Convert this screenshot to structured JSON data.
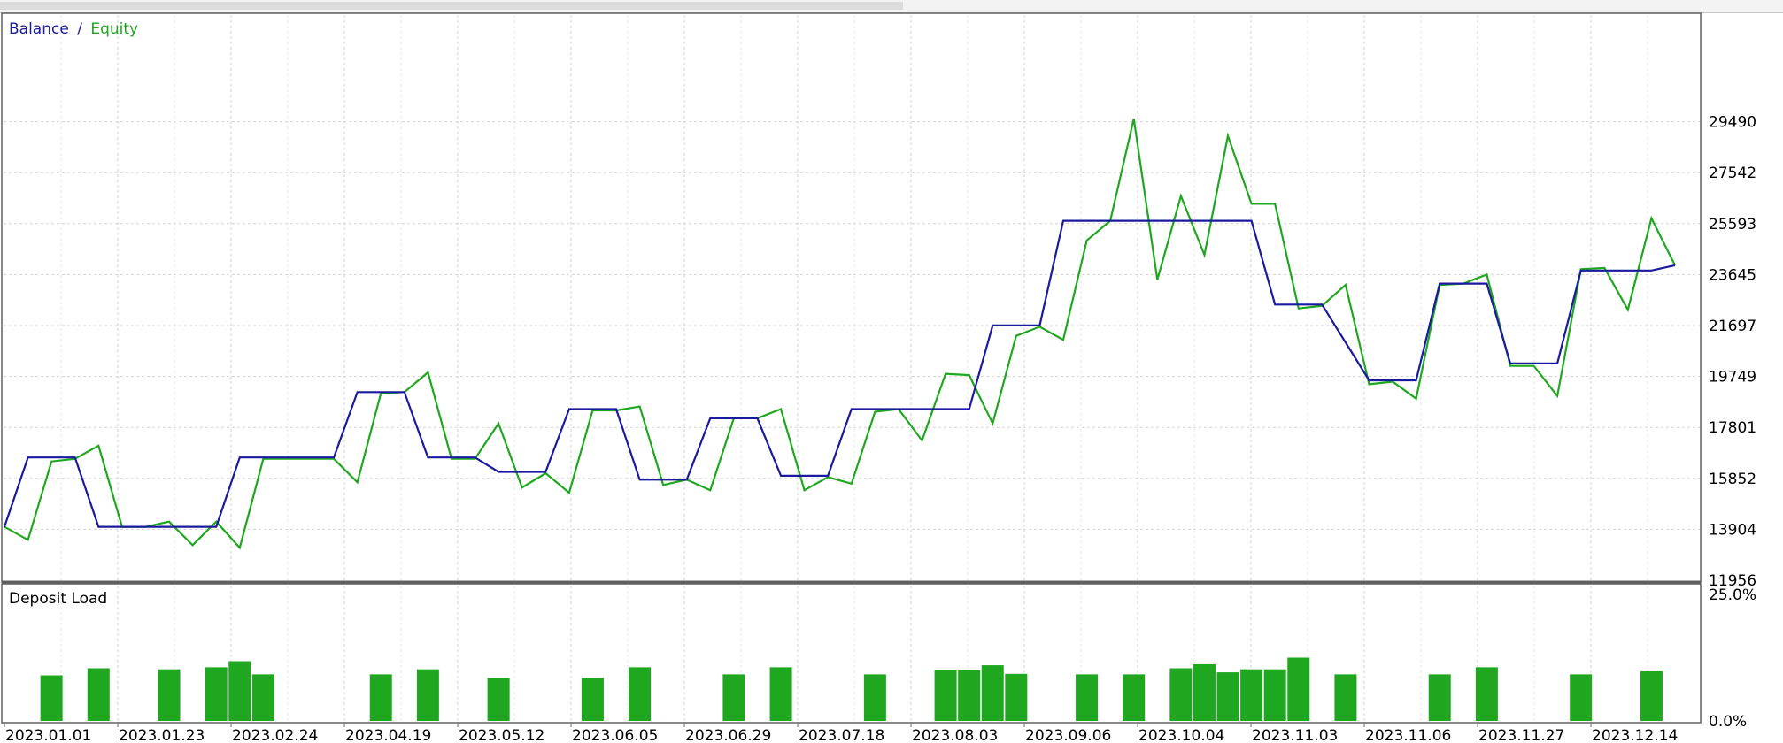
{
  "chart_data": [
    {
      "type": "line",
      "title": "",
      "legend": {
        "entries": [
          {
            "label": "Balance",
            "color": "#1a1a9e"
          },
          {
            "label": "Equity",
            "color": "#1fa71f"
          }
        ],
        "separator": "/",
        "placement": "top-left"
      },
      "y_ticks": [
        "29490",
        "27542",
        "25593",
        "23645",
        "21697",
        "19749",
        "17801",
        "15852",
        "13904",
        "11956"
      ],
      "ylim": [
        11956,
        31438
      ],
      "grid": true,
      "x_index_range": [
        0,
        71
      ],
      "series": [
        {
          "name": "Balance",
          "color": "#1a1a9e",
          "points": [
            [
              0,
              14000
            ],
            [
              1,
              16650
            ],
            [
              3,
              16650
            ],
            [
              4,
              14000
            ],
            [
              6,
              14000
            ],
            [
              9,
              14000
            ],
            [
              10,
              16650
            ],
            [
              14,
              16650
            ],
            [
              15,
              19150
            ],
            [
              17,
              19150
            ],
            [
              18,
              16650
            ],
            [
              20,
              16650
            ],
            [
              21,
              16100
            ],
            [
              23,
              16100
            ],
            [
              24,
              18500
            ],
            [
              26,
              18500
            ],
            [
              27,
              15800
            ],
            [
              29,
              15800
            ],
            [
              30,
              18150
            ],
            [
              32,
              18150
            ],
            [
              33,
              15950
            ],
            [
              35,
              15950
            ],
            [
              36,
              18500
            ],
            [
              41,
              18500
            ],
            [
              42,
              21700
            ],
            [
              44,
              21700
            ],
            [
              45,
              25700
            ],
            [
              53,
              25700
            ],
            [
              54,
              22500
            ],
            [
              56,
              22500
            ],
            [
              58,
              19600
            ],
            [
              60,
              19600
            ],
            [
              61,
              23300
            ],
            [
              63,
              23300
            ],
            [
              64,
              20250
            ],
            [
              66,
              20250
            ],
            [
              67,
              23800
            ],
            [
              70,
              23800
            ],
            [
              71,
              24000
            ]
          ]
        },
        {
          "name": "Equity",
          "color": "#1fa71f",
          "points": [
            [
              0,
              14000
            ],
            [
              1,
              13500
            ],
            [
              2,
              16500
            ],
            [
              3,
              16600
            ],
            [
              4,
              17100
            ],
            [
              5,
              14000
            ],
            [
              6,
              14000
            ],
            [
              7,
              14200
            ],
            [
              8,
              13300
            ],
            [
              9,
              14200
            ],
            [
              10,
              13200
            ],
            [
              11,
              16600
            ],
            [
              14,
              16600
            ],
            [
              15,
              15700
            ],
            [
              16,
              19100
            ],
            [
              17,
              19150
            ],
            [
              18,
              19900
            ],
            [
              19,
              16600
            ],
            [
              20,
              16600
            ],
            [
              21,
              17950
            ],
            [
              22,
              15500
            ],
            [
              23,
              16050
            ],
            [
              24,
              15300
            ],
            [
              25,
              18450
            ],
            [
              26,
              18450
            ],
            [
              27,
              18600
            ],
            [
              28,
              15600
            ],
            [
              29,
              15800
            ],
            [
              30,
              15400
            ],
            [
              31,
              18150
            ],
            [
              32,
              18150
            ],
            [
              33,
              18500
            ],
            [
              34,
              15400
            ],
            [
              35,
              15900
            ],
            [
              36,
              15650
            ],
            [
              37,
              18400
            ],
            [
              38,
              18500
            ],
            [
              39,
              17300
            ],
            [
              40,
              19850
            ],
            [
              41,
              19800
            ],
            [
              42,
              17950
            ],
            [
              43,
              21300
            ],
            [
              44,
              21650
            ],
            [
              45,
              21150
            ],
            [
              46,
              24950
            ],
            [
              47,
              25700
            ],
            [
              48,
              29600
            ],
            [
              49,
              23450
            ],
            [
              50,
              26650
            ],
            [
              51,
              24400
            ],
            [
              52,
              28950
            ],
            [
              53,
              26350
            ],
            [
              54,
              26350
            ],
            [
              55,
              22350
            ],
            [
              56,
              22450
            ],
            [
              57,
              23250
            ],
            [
              58,
              19450
            ],
            [
              59,
              19550
            ],
            [
              60,
              18900
            ],
            [
              61,
              23250
            ],
            [
              62,
              23300
            ],
            [
              63,
              23650
            ],
            [
              64,
              20150
            ],
            [
              65,
              20150
            ],
            [
              66,
              19000
            ],
            [
              67,
              23850
            ],
            [
              68,
              23900
            ],
            [
              69,
              22300
            ],
            [
              70,
              25800
            ],
            [
              71,
              24000
            ]
          ]
        }
      ]
    },
    {
      "type": "bar",
      "title": "Deposit Load",
      "y_ticks": [
        "25.0%",
        "0.0%"
      ],
      "ylim": [
        0,
        25
      ],
      "x_index_range": [
        0,
        71
      ],
      "color": "#1fa71f",
      "bars": [
        [
          2,
          9.0
        ],
        [
          4,
          10.4
        ],
        [
          7,
          10.2
        ],
        [
          9,
          10.6
        ],
        [
          10,
          11.8
        ],
        [
          11,
          9.2
        ],
        [
          16,
          9.2
        ],
        [
          18,
          10.2
        ],
        [
          21,
          8.5
        ],
        [
          25,
          8.5
        ],
        [
          27,
          10.6
        ],
        [
          31,
          9.2
        ],
        [
          33,
          10.6
        ],
        [
          37,
          9.2
        ],
        [
          40,
          10.0
        ],
        [
          41,
          10.0
        ],
        [
          42,
          11.0
        ],
        [
          43,
          9.3
        ],
        [
          46,
          9.2
        ],
        [
          48,
          9.2
        ],
        [
          50,
          10.4
        ],
        [
          51,
          11.2
        ],
        [
          52,
          9.6
        ],
        [
          53,
          10.2
        ],
        [
          54,
          10.2
        ],
        [
          55,
          12.5
        ],
        [
          57,
          9.2
        ],
        [
          61,
          9.2
        ],
        [
          63,
          10.6
        ],
        [
          67,
          9.2
        ],
        [
          70,
          9.8
        ]
      ]
    }
  ],
  "x_axis": {
    "labels": [
      "2023.01.01",
      "2023.01.23",
      "2023.02.24",
      "2023.04.19",
      "2023.05.12",
      "2023.06.05",
      "2023.06.29",
      "2023.07.18",
      "2023.08.03",
      "2023.09.06",
      "2023.10.04",
      "2023.11.03",
      "2023.11.06",
      "2023.11.27",
      "2023.12.14"
    ]
  }
}
